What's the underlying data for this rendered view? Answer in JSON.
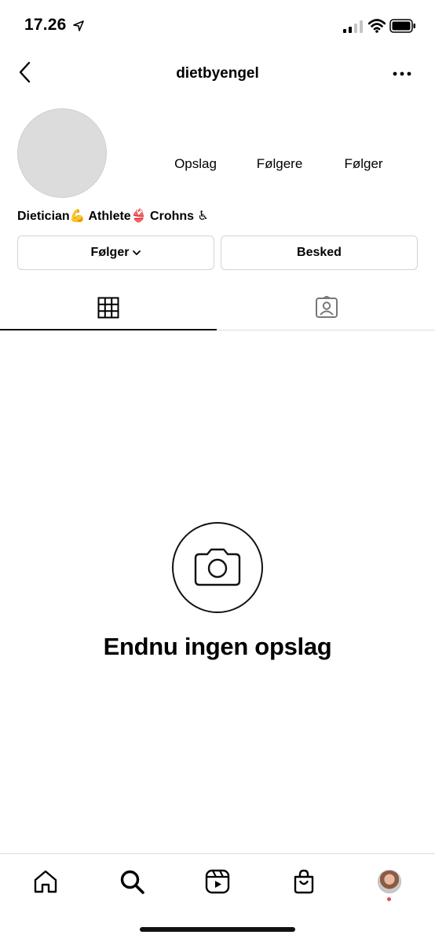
{
  "status_bar": {
    "time": "17.26"
  },
  "header": {
    "username": "dietbyengel"
  },
  "profile": {
    "stats": {
      "posts_label": "Opslag",
      "followers_label": "Følgere",
      "following_label": "Følger"
    },
    "bio": "Dietician💪 Athlete👙 Crohns ♿"
  },
  "actions": {
    "follow_label": "Følger",
    "message_label": "Besked"
  },
  "tabs": [
    {
      "name": "grid",
      "icon": "grid-icon",
      "active": true
    },
    {
      "name": "tagged",
      "icon": "tagged-person-icon",
      "active": false
    }
  ],
  "empty_state": {
    "icon": "camera-icon",
    "title": "Endnu ingen opslag"
  },
  "bottom_nav": [
    {
      "name": "home",
      "icon": "home-icon"
    },
    {
      "name": "search",
      "icon": "search-icon"
    },
    {
      "name": "reels",
      "icon": "reels-icon"
    },
    {
      "name": "shop",
      "icon": "shopping-bag-icon"
    },
    {
      "name": "profile",
      "icon": "profile-avatar",
      "has_notification": true
    }
  ],
  "colors": {
    "notification_dot": "#ed4956",
    "avatar_placeholder": "#dcdcdc",
    "divider": "#dbdbdb"
  }
}
